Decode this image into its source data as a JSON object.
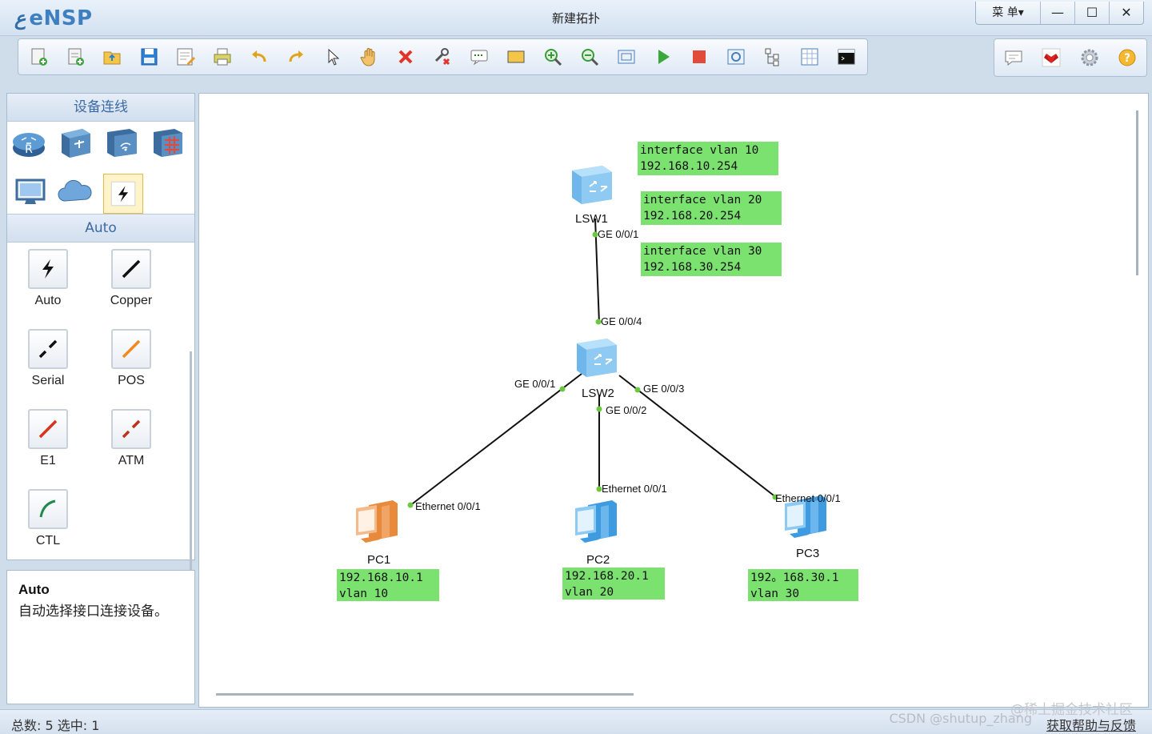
{
  "window": {
    "app_name": "eNSP",
    "title": "新建拓扑",
    "menu_label": "菜 单▾",
    "minimize": "—",
    "maximize": "☐",
    "close": "✕"
  },
  "toolbar": {
    "buttons": [
      "new-topology",
      "new-test",
      "open",
      "save",
      "save-as",
      "print",
      "undo",
      "redo",
      "select",
      "pan",
      "delete",
      "delete-link",
      "text",
      "rectangle",
      "zoom-in",
      "zoom-out",
      "fit",
      "start-all",
      "stop-all",
      "capture",
      "topology",
      "grid",
      "command-line"
    ],
    "right_buttons": [
      "chat",
      "huawei",
      "settings",
      "help"
    ]
  },
  "palette": {
    "header": "设备连线",
    "category_label": "Auto",
    "device_categories": [
      "router",
      "switch",
      "wireless",
      "firewall",
      "terminal",
      "cloud",
      "connection"
    ],
    "connections": [
      {
        "label": "Auto",
        "color": "#111111"
      },
      {
        "label": "Copper",
        "color": "#111111"
      },
      {
        "label": "Serial",
        "color": "#111111"
      },
      {
        "label": "POS",
        "color": "#f08a1c"
      },
      {
        "label": "E1",
        "color": "#d9341a"
      },
      {
        "label": "ATM",
        "color": "#c0301a"
      },
      {
        "label": "CTL",
        "color": "#1e8a4c"
      }
    ]
  },
  "description": {
    "title": "Auto",
    "text": "自动选择接口连接设备。"
  },
  "topology": {
    "devices": [
      {
        "name": "LSW1",
        "type": "switch"
      },
      {
        "name": "LSW2",
        "type": "switch"
      },
      {
        "name": "PC1",
        "type": "pc"
      },
      {
        "name": "PC2",
        "type": "pc"
      },
      {
        "name": "PC3",
        "type": "pc"
      }
    ],
    "interface_labels": {
      "lsw1_ge001": "GE 0/0/1",
      "lsw2_ge004": "GE 0/0/4",
      "lsw2_ge001": "GE 0/0/1",
      "lsw2_ge002": "GE 0/0/2",
      "lsw2_ge003": "GE 0/0/3",
      "pc1_eth": "Ethernet 0/0/1",
      "pc2_eth": "Ethernet 0/0/1",
      "pc3_eth": "Ethernet 0/0/1"
    },
    "notes": {
      "vlan10": "interface vlan 10\n192.168.10.254",
      "vlan20": "interface vlan 20\n192.168.20.254",
      "vlan30": "interface vlan 30\n192.168.30.254",
      "pc1": "192.168.10.1\nvlan 10",
      "pc2": "192.168.20.1\nvlan 20",
      "pc3": "192。168.30.1\nvlan 30"
    }
  },
  "status": {
    "left": "总数: 5 选中: 1",
    "right": "获取帮助与反馈"
  },
  "watermark": {
    "line1": "@稀土掘金技术社区",
    "line2": "CSDN @shutup_zhang"
  },
  "colors": {
    "note_bg": "#7be26f",
    "link_dot": "#6cc93f",
    "accent": "#3d7fbf"
  }
}
